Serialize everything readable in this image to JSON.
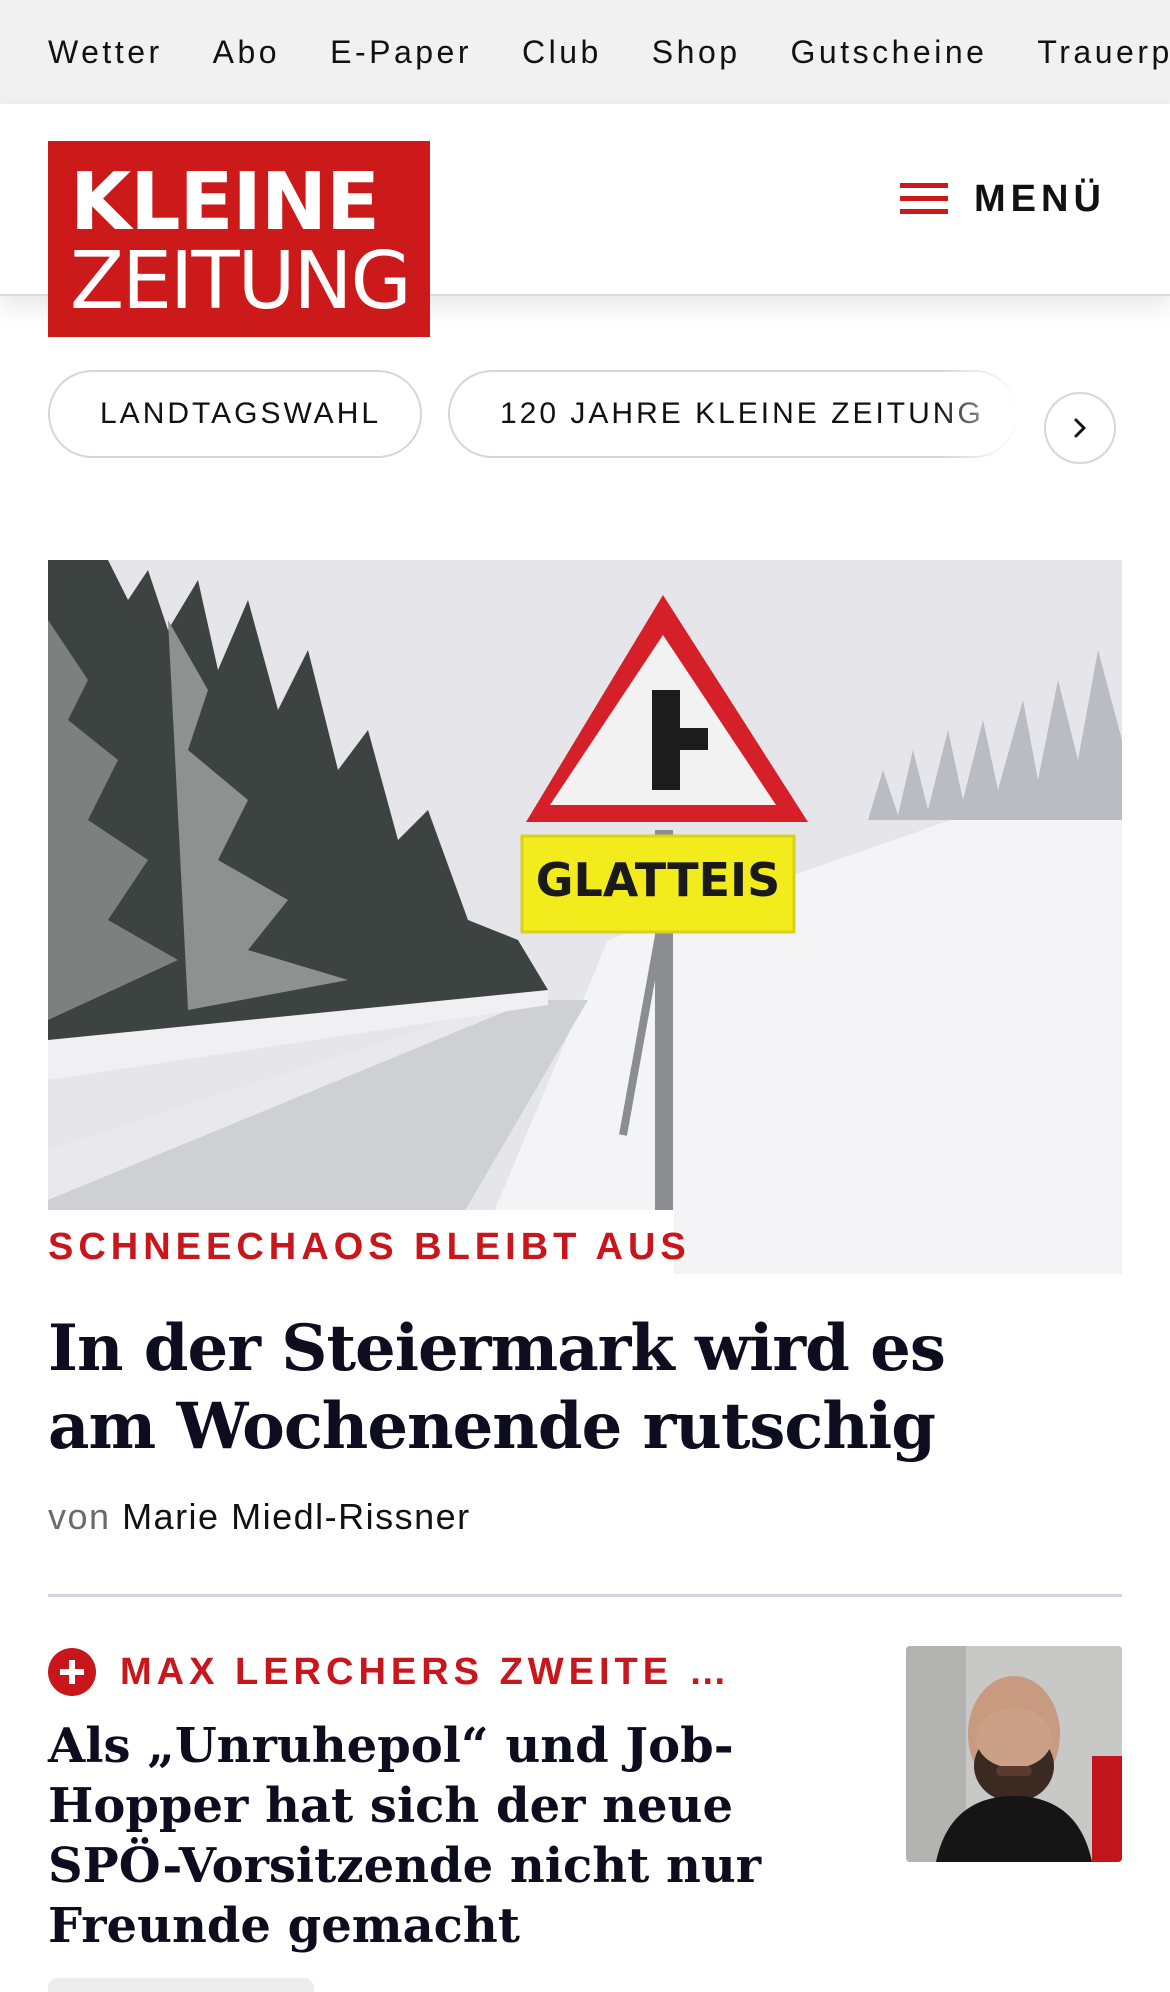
{
  "topbar": {
    "links": [
      "Wetter",
      "Abo",
      "E-Paper",
      "Club",
      "Shop",
      "Gutscheine",
      "Trauerportal"
    ]
  },
  "header": {
    "logo": {
      "line1": "KLEINE",
      "line2": "ZEITUNG"
    },
    "menu_label": "MENÜ"
  },
  "topics": {
    "pills": [
      "LANDTAGSWAHL",
      "120 JAHRE KLEINE ZEITUNG"
    ],
    "next_icon": "chevron-right-icon"
  },
  "lead_article": {
    "image_sign_text": "GLATTEIS",
    "kicker": "SCHNEECHAOS BLEIBT AUS",
    "headline": "In der Steiermark wird es am Wochenende rutschig",
    "byline_prefix": "von",
    "author": "Marie Miedl-Rissner"
  },
  "second_article": {
    "premium_icon": "plus-icon",
    "kicker": "MAX LERCHERS ZWEITE KA…",
    "headline": "Als „Unruhepol“ und Job-Hopper hat sich der neue SPÖ-Vorsitzende nicht nur Freunde gemacht"
  },
  "colors": {
    "brand_red": "#cc1a1a",
    "kicker_red": "#c8161d",
    "headline": "#0d0d1f",
    "topbar_bg": "#f1f1f1"
  }
}
